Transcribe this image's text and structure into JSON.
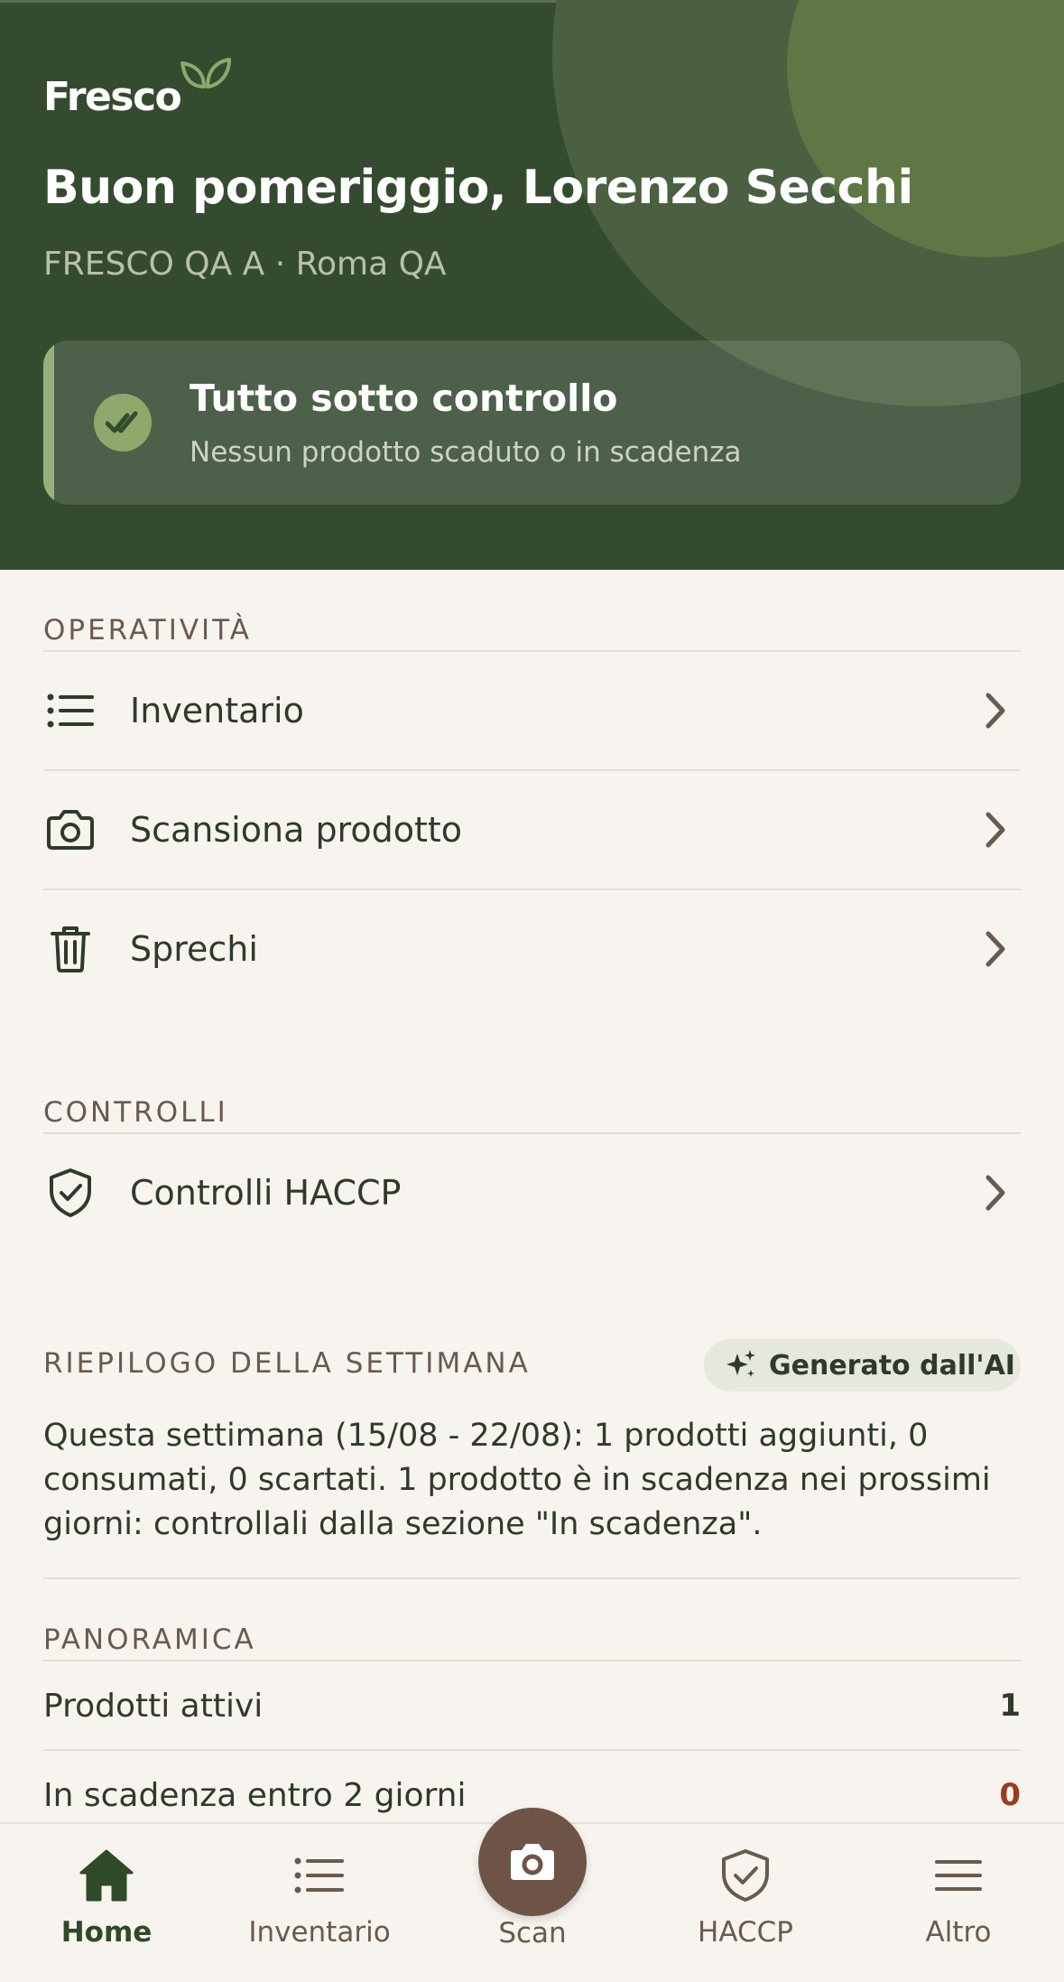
{
  "header": {
    "logo": "Fresco",
    "greeting": "Buon pomeriggio, Lorenzo Secchi",
    "location": "FRESCO QA A · Roma QA",
    "status_card": {
      "title": "Tutto sotto controllo",
      "subtitle": "Nessun prodotto scaduto o in scadenza",
      "icon": "double-check-icon"
    }
  },
  "sections": {
    "operativita": {
      "label": "OPERATIVITÀ",
      "items": [
        {
          "label": "Inventario",
          "icon": "list-icon"
        },
        {
          "label": "Scansiona prodotto",
          "icon": "camera-icon"
        },
        {
          "label": "Sprechi",
          "icon": "trash-icon"
        }
      ]
    },
    "controlli": {
      "label": "CONTROLLI",
      "items": [
        {
          "label": "Controlli HACCP",
          "icon": "shield-check-icon"
        }
      ]
    },
    "riepilogo": {
      "label": "RIEPILOGO DELLA SETTIMANA",
      "badge": "Generato dall'AI",
      "text": "Questa settimana (15/08 - 22/08): 1 prodotti aggiunti, 0 consumati, 0 scartati. 1 prodotto è in scadenza nei prossimi giorni: controllali dalla sezione \"In scadenza\"."
    },
    "panoramica": {
      "label": "PANORAMICA",
      "stats": [
        {
          "label": "Prodotti attivi",
          "value": "1"
        },
        {
          "label": "In scadenza entro 2 giorni",
          "value": "0"
        }
      ]
    }
  },
  "bottom_nav": [
    {
      "label": "Home",
      "icon": "home-icon",
      "active": true
    },
    {
      "label": "Inventario",
      "icon": "list-icon"
    },
    {
      "label": "Scan",
      "icon": "camera-icon"
    },
    {
      "label": "HACCP",
      "icon": "shield-check-icon"
    },
    {
      "label": "Altro",
      "icon": "menu-icon"
    }
  ],
  "colors": {
    "header_bg": "#354b30",
    "accent_green": "#8fa86c",
    "brown": "#6e5446",
    "warning_value": "#9a3b22"
  }
}
